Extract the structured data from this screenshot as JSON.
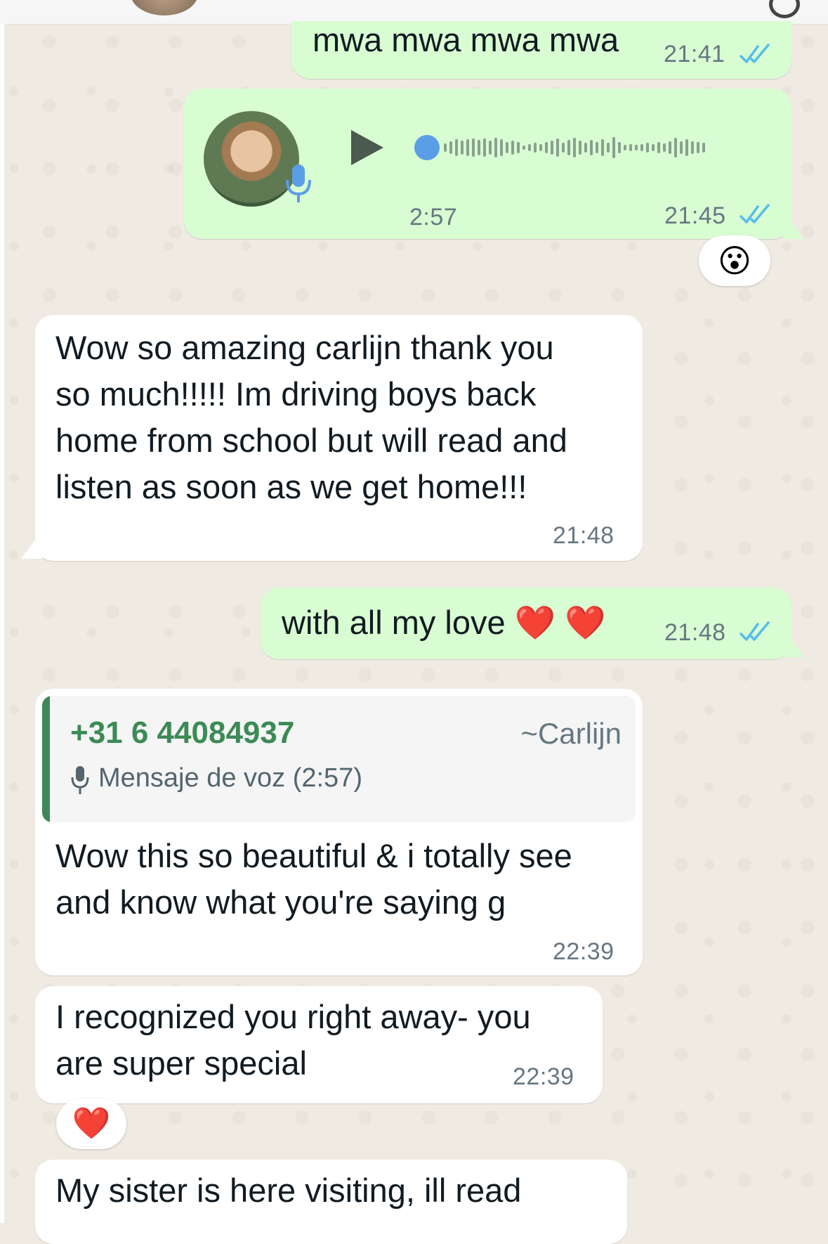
{
  "chat": {
    "messages": [
      {
        "id": "m1",
        "direction": "outgoing",
        "text": "mwa mwa mwa mwa",
        "time": "21:41",
        "status": "read"
      },
      {
        "id": "m2",
        "direction": "outgoing",
        "type": "voice",
        "duration": "2:57",
        "time": "21:45",
        "status": "read",
        "reaction": "😮"
      },
      {
        "id": "m3",
        "direction": "incoming",
        "text": "Wow so amazing carlijn thank you\nso much!!!!! Im driving boys back\nhome from school but will read and\nlisten as soon as we get home!!!",
        "time": "21:48"
      },
      {
        "id": "m4",
        "direction": "outgoing",
        "text": "with all my love ❤️ ❤️",
        "time": "21:48",
        "status": "read"
      },
      {
        "id": "m5",
        "direction": "incoming",
        "quote": {
          "sender_phone": "+31 6 44084937",
          "sender_name": "~Carlijn",
          "text": "Mensaje de voz (2:57)"
        },
        "text": "Wow this so beautiful & i totally see\nand know what you're saying g",
        "time": "22:39"
      },
      {
        "id": "m6",
        "direction": "incoming",
        "text": "I recognized you right away- you\nare super special",
        "time": "22:39",
        "reaction": "❤️"
      },
      {
        "id": "m7",
        "direction": "incoming",
        "text": "My sister is here visiting, ill read"
      }
    ]
  },
  "colors": {
    "outgoing_bubble": "#d9fdd3",
    "incoming_bubble": "#ffffff",
    "read_ticks": "#53bdeb",
    "quote_accent": "#3c8a55",
    "chat_background": "#efeae2"
  },
  "icons": {
    "play": "play-icon",
    "mic": "microphone-icon",
    "ticks": "double-check-icon"
  }
}
